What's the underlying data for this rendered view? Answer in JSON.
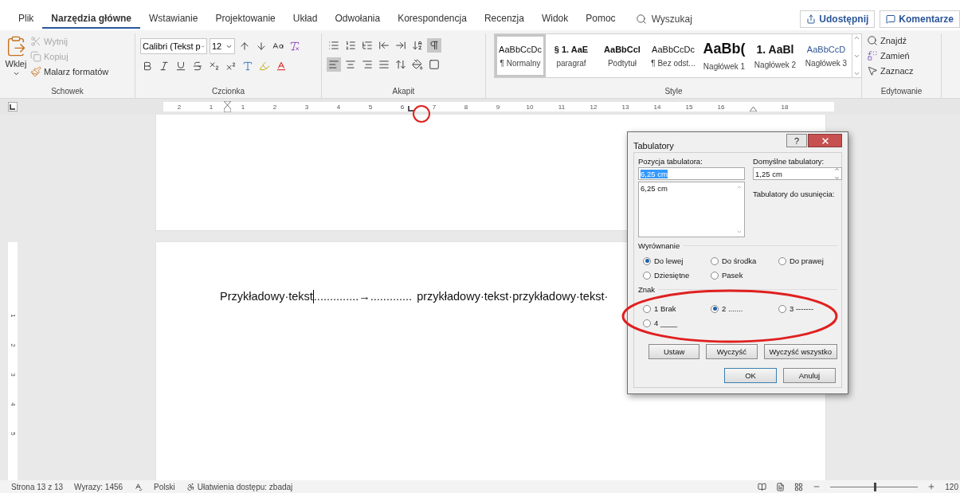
{
  "tabs": [
    {
      "label": "Plik",
      "selected": false
    },
    {
      "label": "Narzędzia główne",
      "selected": true
    },
    {
      "label": "Wstawianie",
      "selected": false
    },
    {
      "label": "Projektowanie",
      "selected": false
    },
    {
      "label": "Układ",
      "selected": false
    },
    {
      "label": "Odwołania",
      "selected": false
    },
    {
      "label": "Korespondencja",
      "selected": false
    },
    {
      "label": "Recenzja",
      "selected": false
    },
    {
      "label": "Widok",
      "selected": false
    },
    {
      "label": "Pomoc",
      "selected": false
    }
  ],
  "search": {
    "placeholder": "Wyszukaj"
  },
  "share_button": "Udostępnij",
  "comments_button": "Komentarze",
  "clipboard": {
    "label": "Schowek",
    "paste": "Wklej",
    "items": [
      {
        "kind": "cut",
        "label": "Wytnij",
        "disabled": true
      },
      {
        "kind": "copy",
        "label": "Kopiuj",
        "disabled": true
      },
      {
        "kind": "painter",
        "label": "Malarz formatów",
        "disabled": false
      }
    ]
  },
  "font": {
    "label": "Czcionka",
    "font_name": "Calibri (Tekst p",
    "font_size": "12"
  },
  "paragraph": {
    "label": "Akapit",
    "show_marks": true,
    "align_buttons": [
      {
        "kind": "left",
        "selected": true
      },
      {
        "kind": "center",
        "selected": false
      },
      {
        "kind": "right",
        "selected": false
      },
      {
        "kind": "justify",
        "selected": false
      }
    ]
  },
  "styles": {
    "label": "Style",
    "items": [
      {
        "preview": "AaBbCcDc",
        "name": "¶ Normalny",
        "kind": "normal",
        "selected": true
      },
      {
        "preview": "§ 1.  AaE",
        "name": "paragraf",
        "kind": "bold",
        "selected": false
      },
      {
        "preview": "AaBbCcl",
        "name": "Podtytuł",
        "kind": "bold",
        "selected": false
      },
      {
        "preview": "AaBbCcDc",
        "name": "¶ Bez odst...",
        "kind": "normal",
        "selected": false
      },
      {
        "preview": "AaBb(",
        "name": "Nagłówek 1",
        "kind": "large",
        "selected": false
      },
      {
        "preview": "1.  AaBl",
        "name": "Nagłówek 2",
        "kind": "medium",
        "selected": false
      },
      {
        "preview": "AaBbCcD",
        "name": "Nagłówek 3",
        "kind": "blue",
        "selected": false
      }
    ]
  },
  "editing": {
    "label": "Edytowanie",
    "items": [
      {
        "kind": "find",
        "label": "Znajdź"
      },
      {
        "kind": "replace",
        "label": "Zamień"
      },
      {
        "kind": "select",
        "label": "Zaznacz"
      }
    ]
  },
  "ruler": {
    "marks": [
      {
        "kind": "number",
        "label": "2"
      },
      {
        "kind": "number",
        "label": "1"
      },
      {
        "kind": "left-indent"
      },
      {
        "kind": "number",
        "label": "1"
      },
      {
        "kind": "number",
        "label": "2"
      },
      {
        "kind": "number",
        "label": "3"
      },
      {
        "kind": "number",
        "label": "4"
      },
      {
        "kind": "number",
        "label": "5"
      },
      {
        "kind": "number",
        "label": "6"
      },
      {
        "kind": "tab-stop"
      },
      {
        "kind": "number",
        "label": "7"
      },
      {
        "kind": "number",
        "label": "8"
      },
      {
        "kind": "number",
        "label": "9"
      },
      {
        "kind": "number",
        "label": "10"
      },
      {
        "kind": "number",
        "label": "11"
      },
      {
        "kind": "number",
        "label": "12"
      },
      {
        "kind": "number",
        "label": "13"
      },
      {
        "kind": "number",
        "label": "14"
      },
      {
        "kind": "number",
        "label": "15"
      },
      {
        "kind": "number",
        "label": "16"
      },
      {
        "kind": "right-indent"
      },
      {
        "kind": "number",
        "label": "18"
      }
    ]
  },
  "vertical_ruler": [
    "1",
    "2",
    "3",
    "4",
    "5"
  ],
  "document": {
    "text_before": "Przykładowy·tekst",
    "leader": "..............→.............",
    "text_after": "przykładowy·tekst·przykładowy·tekst·"
  },
  "dialog": {
    "title": "Tabulatory",
    "help": "?",
    "position_label": "Pozycja tabulatora:",
    "position_value": "6,25 cm",
    "position_list": [
      "6,25 cm"
    ],
    "default_label": "Domyślne tabulatory:",
    "default_value": "1,25 cm",
    "clear_label": "Tabulatory do usunięcia:",
    "alignment_label": "Wyrównanie",
    "alignment": [
      {
        "label": "Do lewej",
        "selected": true
      },
      {
        "label": "Do środka",
        "selected": false
      },
      {
        "label": "Do prawej",
        "selected": false
      },
      {
        "label": "Dziesiętne",
        "selected": false
      },
      {
        "label": "Pasek",
        "selected": false
      }
    ],
    "leader_label": "Znak",
    "leaders": [
      {
        "label": "1 Brak",
        "selected": false
      },
      {
        "label": "2 .......",
        "selected": true
      },
      {
        "label": "3 -------",
        "selected": false
      },
      {
        "label": "4 ____",
        "selected": false
      }
    ],
    "buttons": [
      {
        "label": "Ustaw",
        "default": false
      },
      {
        "label": "Wyczyść",
        "default": false
      },
      {
        "label": "Wyczyść wszystko",
        "default": false
      }
    ],
    "ok": "OK",
    "cancel": "Anuluj"
  },
  "status_bar": {
    "page": "Strona 13 z 13",
    "words": "Wyrazy: 1456",
    "language": "Polski",
    "accessibility": "Ułatwienia dostępu: zbadaj",
    "zoom": "120",
    "zoom_level": {
      "level": 0.5
    }
  }
}
